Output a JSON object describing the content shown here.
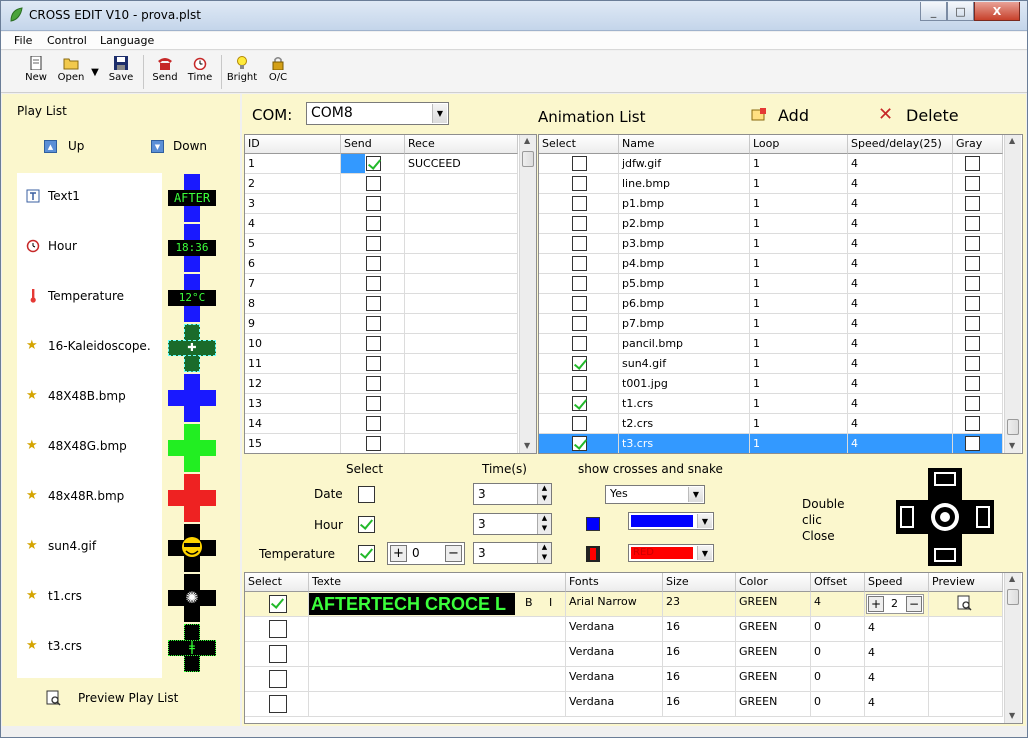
{
  "window": {
    "title": "CROSS EDIT V10 - prova.plst",
    "minimize": "_",
    "maximize": "□",
    "close": "X"
  },
  "menu": {
    "file": "File",
    "control": "Control",
    "language": "Language"
  },
  "toolbar": {
    "new": "New",
    "open": "Open",
    "save": "Save",
    "send": "Send",
    "time": "Time",
    "bright": "Bright",
    "oc": "O/C"
  },
  "playlist": {
    "title": "Play List",
    "up": "Up",
    "down": "Down",
    "items": [
      {
        "label": "Text1",
        "icon": "text-icon",
        "thumb": "AFTER"
      },
      {
        "label": "Hour",
        "icon": "clock-icon",
        "thumb": "18:36"
      },
      {
        "label": "Temperature",
        "icon": "thermometer-icon",
        "thumb": "12°C"
      },
      {
        "label": "16-Kaleidoscope.",
        "icon": "star-icon",
        "thumb": ""
      },
      {
        "label": "48X48B.bmp",
        "icon": "star-icon",
        "thumb": ""
      },
      {
        "label": "48X48G.bmp",
        "icon": "star-icon",
        "thumb": ""
      },
      {
        "label": "48x48R.bmp",
        "icon": "star-icon",
        "thumb": ""
      },
      {
        "label": "sun4.gif",
        "icon": "star-icon",
        "thumb": ""
      },
      {
        "label": "t1.crs",
        "icon": "star-icon",
        "thumb": ""
      },
      {
        "label": "t3.crs",
        "icon": "star-icon",
        "thumb": ""
      }
    ],
    "preview": "Preview Play List"
  },
  "com": {
    "label": "COM:",
    "value": "COM8"
  },
  "animation": {
    "title": "Animation List",
    "add": "Add",
    "delete": "Delete"
  },
  "sendgrid": {
    "headers": [
      "ID",
      "Send",
      "Rece"
    ],
    "rows": [
      {
        "id": "1",
        "send": true,
        "rece": "SUCCEED"
      },
      {
        "id": "2",
        "send": false,
        "rece": ""
      },
      {
        "id": "3",
        "send": false,
        "rece": ""
      },
      {
        "id": "4",
        "send": false,
        "rece": ""
      },
      {
        "id": "5",
        "send": false,
        "rece": ""
      },
      {
        "id": "6",
        "send": false,
        "rece": ""
      },
      {
        "id": "7",
        "send": false,
        "rece": ""
      },
      {
        "id": "8",
        "send": false,
        "rece": ""
      },
      {
        "id": "9",
        "send": false,
        "rece": ""
      },
      {
        "id": "10",
        "send": false,
        "rece": ""
      },
      {
        "id": "11",
        "send": false,
        "rece": ""
      },
      {
        "id": "12",
        "send": false,
        "rece": ""
      },
      {
        "id": "13",
        "send": false,
        "rece": ""
      },
      {
        "id": "14",
        "send": false,
        "rece": ""
      },
      {
        "id": "15",
        "send": false,
        "rece": ""
      }
    ]
  },
  "animgrid": {
    "headers": [
      "Select",
      "Name",
      "Loop",
      "Speed/delay(25)",
      "Gray"
    ],
    "rows": [
      {
        "select": false,
        "name": "jdfw.gif",
        "loop": "1",
        "speed": "4",
        "gray": false
      },
      {
        "select": false,
        "name": "line.bmp",
        "loop": "1",
        "speed": "4",
        "gray": false
      },
      {
        "select": false,
        "name": "p1.bmp",
        "loop": "1",
        "speed": "4",
        "gray": false
      },
      {
        "select": false,
        "name": "p2.bmp",
        "loop": "1",
        "speed": "4",
        "gray": false
      },
      {
        "select": false,
        "name": "p3.bmp",
        "loop": "1",
        "speed": "4",
        "gray": false
      },
      {
        "select": false,
        "name": "p4.bmp",
        "loop": "1",
        "speed": "4",
        "gray": false
      },
      {
        "select": false,
        "name": "p5.bmp",
        "loop": "1",
        "speed": "4",
        "gray": false
      },
      {
        "select": false,
        "name": "p6.bmp",
        "loop": "1",
        "speed": "4",
        "gray": false
      },
      {
        "select": false,
        "name": "p7.bmp",
        "loop": "1",
        "speed": "4",
        "gray": false
      },
      {
        "select": false,
        "name": "pancil.bmp",
        "loop": "1",
        "speed": "4",
        "gray": false
      },
      {
        "select": true,
        "name": "sun4.gif",
        "loop": "1",
        "speed": "4",
        "gray": false
      },
      {
        "select": false,
        "name": "t001.jpg",
        "loop": "1",
        "speed": "4",
        "gray": false
      },
      {
        "select": true,
        "name": "t1.crs",
        "loop": "1",
        "speed": "4",
        "gray": false
      },
      {
        "select": false,
        "name": "t2.crs",
        "loop": "1",
        "speed": "4",
        "gray": false
      },
      {
        "select": true,
        "name": "t3.crs",
        "loop": "1",
        "speed": "4",
        "gray": false
      }
    ]
  },
  "options": {
    "select_label": "Select",
    "time_label": "Time(s)",
    "show_label": "show crosses and snake",
    "date_label": "Date",
    "hour_label": "Hour",
    "temperature_label": "Temperature",
    "date_checked": false,
    "hour_checked": true,
    "temp_checked": true,
    "date_time": "3",
    "hour_time": "3",
    "temp_time": "3",
    "temp_offset": "0",
    "show_value": "Yes",
    "color1_value": "BLUE",
    "color2_value": "RED",
    "double_click": [
      "Double",
      "clic",
      "Close"
    ]
  },
  "textgrid": {
    "headers": [
      "Select",
      "Texte",
      "Fonts",
      "Size",
      "Color",
      "Offset",
      "Speed",
      "Preview"
    ],
    "rows": [
      {
        "select": true,
        "text": "AFTERTECH CROCE L",
        "font": "Arial Narrow",
        "size": "23",
        "color": "GREEN",
        "offset": "4",
        "speed": "2"
      },
      {
        "select": false,
        "text": "",
        "font": "Verdana",
        "size": "16",
        "color": "GREEN",
        "offset": "0",
        "speed": "4"
      },
      {
        "select": false,
        "text": "",
        "font": "Verdana",
        "size": "16",
        "color": "GREEN",
        "offset": "0",
        "speed": "4"
      },
      {
        "select": false,
        "text": "",
        "font": "Verdana",
        "size": "16",
        "color": "GREEN",
        "offset": "0",
        "speed": "4"
      },
      {
        "select": false,
        "text": "",
        "font": "Verdana",
        "size": "16",
        "color": "GREEN",
        "offset": "0",
        "speed": "4"
      }
    ],
    "bold": "B",
    "italic": "I"
  },
  "colors": {
    "pane_bg": "#fbf7cd",
    "selection": "#3399ff",
    "led_green": "#3bff3b",
    "blue_swatch": "#0000ff",
    "red_swatch": "#ff0000"
  }
}
